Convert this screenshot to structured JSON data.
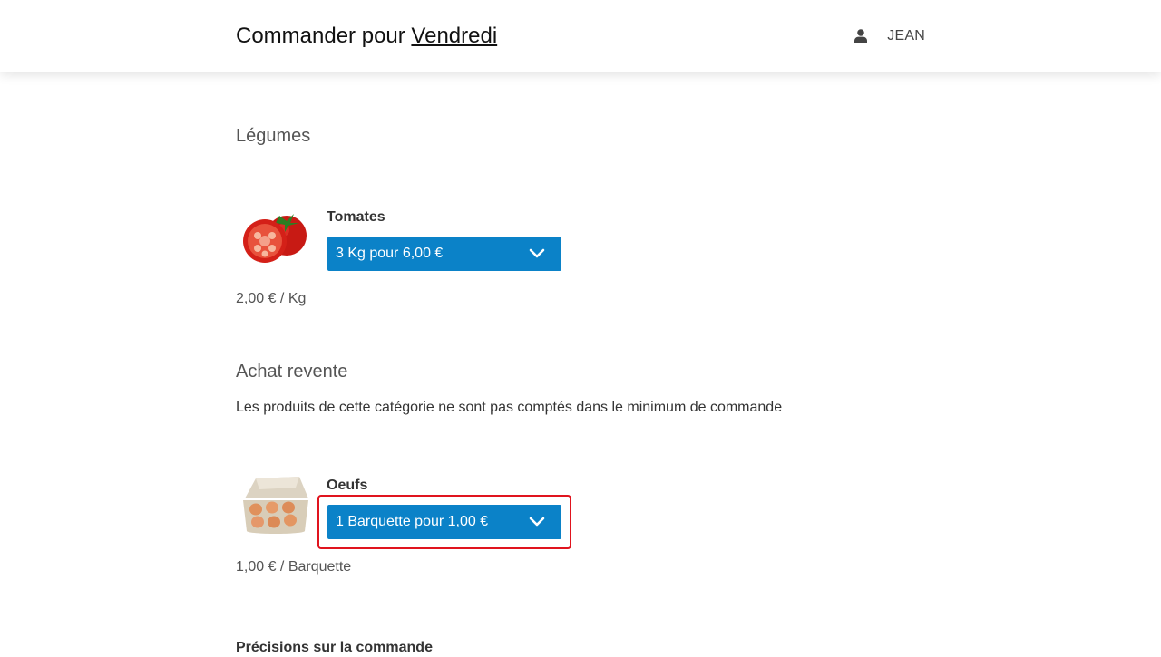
{
  "header": {
    "title_prefix": "Commander pour",
    "day_link": "Vendredi",
    "user_icon": "user-icon",
    "user_name": "JEAN"
  },
  "categories": [
    {
      "title": "Légumes",
      "products": [
        {
          "name": "Tomates",
          "image_icon": "tomato-image",
          "selected_option": "3 Kg pour 6,00 €",
          "unit_price": "2,00 € / Kg"
        }
      ]
    },
    {
      "title": "Achat revente",
      "note": "Les produits de cette catégorie ne sont pas comptés dans le minimum de commande",
      "products": [
        {
          "name": "Oeufs",
          "image_icon": "egg-carton-image",
          "selected_option": "1 Barquette pour 1,00 €",
          "unit_price": "1,00 € / Barquette"
        }
      ]
    }
  ],
  "order_notes": {
    "title": "Précisions sur la commande"
  },
  "colors": {
    "select_bg": "#0b82c8",
    "highlight_border": "#e0141e"
  }
}
